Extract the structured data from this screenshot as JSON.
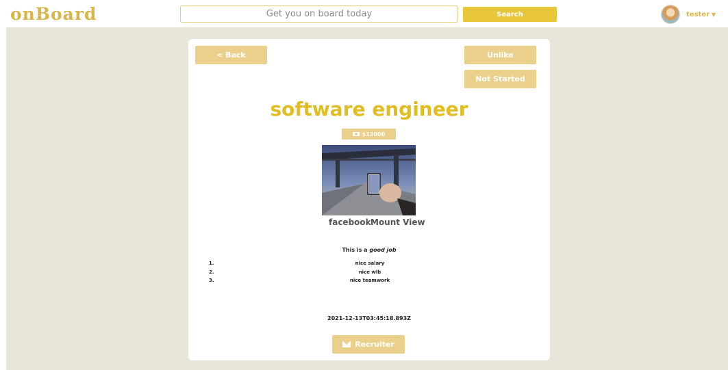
{
  "header": {
    "logo": "onBoard",
    "search": {
      "placeholder": "Get you on board today",
      "button_label": "Search"
    },
    "user": {
      "name": "tester"
    }
  },
  "job": {
    "back_label": "< Back",
    "like_label": "Unlike",
    "status_label": "Not Started",
    "title": "software engineer",
    "salary": "$12000",
    "company": "facebook",
    "location": "Mount View",
    "description_prefix": "This is a ",
    "description_emphasis": "good job",
    "perks": [
      {
        "num": "1.",
        "text": "nice salary"
      },
      {
        "num": "2.",
        "text": "nice wlb"
      },
      {
        "num": "3.",
        "text": "nice teamwork"
      }
    ],
    "date": "2021-12-13T03:45:18.893Z",
    "recruiter_label": "Recruiter"
  },
  "colors": {
    "accent": "#e2bd22",
    "button": "#ebd08c",
    "search_button": "#e8c63a",
    "background": "#e8e6d9"
  }
}
